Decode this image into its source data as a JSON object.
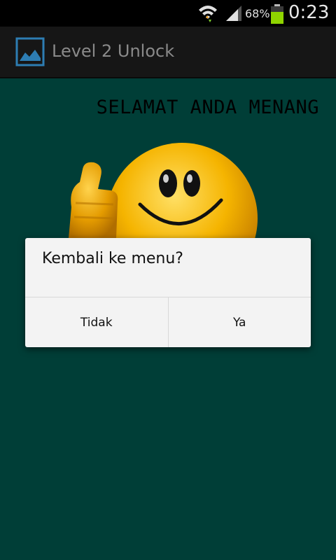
{
  "status_bar": {
    "battery_percent": "68%",
    "time": "0:23",
    "icons": [
      "wifi-icon",
      "signal-icon",
      "battery-icon"
    ],
    "battery_level": 0.68
  },
  "action_bar": {
    "title": "Level 2 Unlock",
    "icon": "image-icon"
  },
  "content": {
    "headline": "SELAMAT ANDA MENANG",
    "image": "thumbs-up-smiley"
  },
  "dialog": {
    "message": "Kembali ke menu?",
    "negative_label": "Tidak",
    "positive_label": "Ya"
  },
  "colors": {
    "background": "#003e37",
    "action_bar": "#161616",
    "dialog": "#f3f3f3",
    "battery": "#8fd400"
  }
}
